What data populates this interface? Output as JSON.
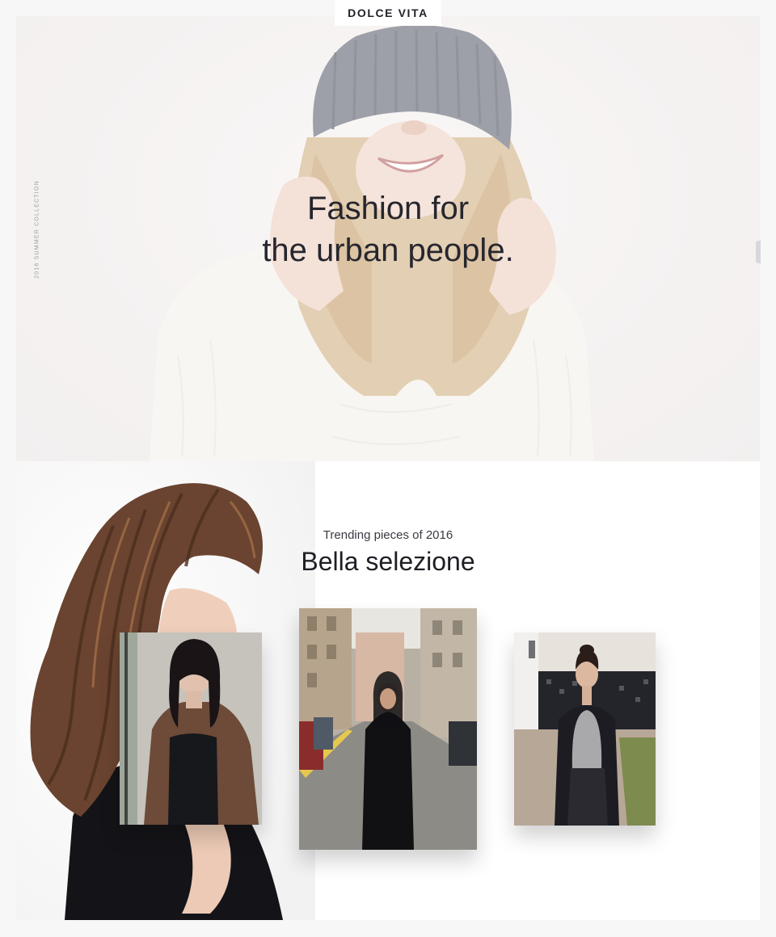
{
  "brand": {
    "name": "DOLCE VITA"
  },
  "hero": {
    "side_label": "2016 SUMMER COLLECTION",
    "headline_line1": "Fashion for",
    "headline_line2": "the urban people."
  },
  "trending": {
    "kicker": "Trending pieces of 2016",
    "title": "Bella selezione"
  },
  "colors": {
    "page_background": "#f7f7f8",
    "text_dark": "#1e1e24",
    "beanie": "#5e6270",
    "sweater": "#f1ece6",
    "hair_blonde": "#c9a878",
    "hair_brown": "#5a3a26"
  }
}
